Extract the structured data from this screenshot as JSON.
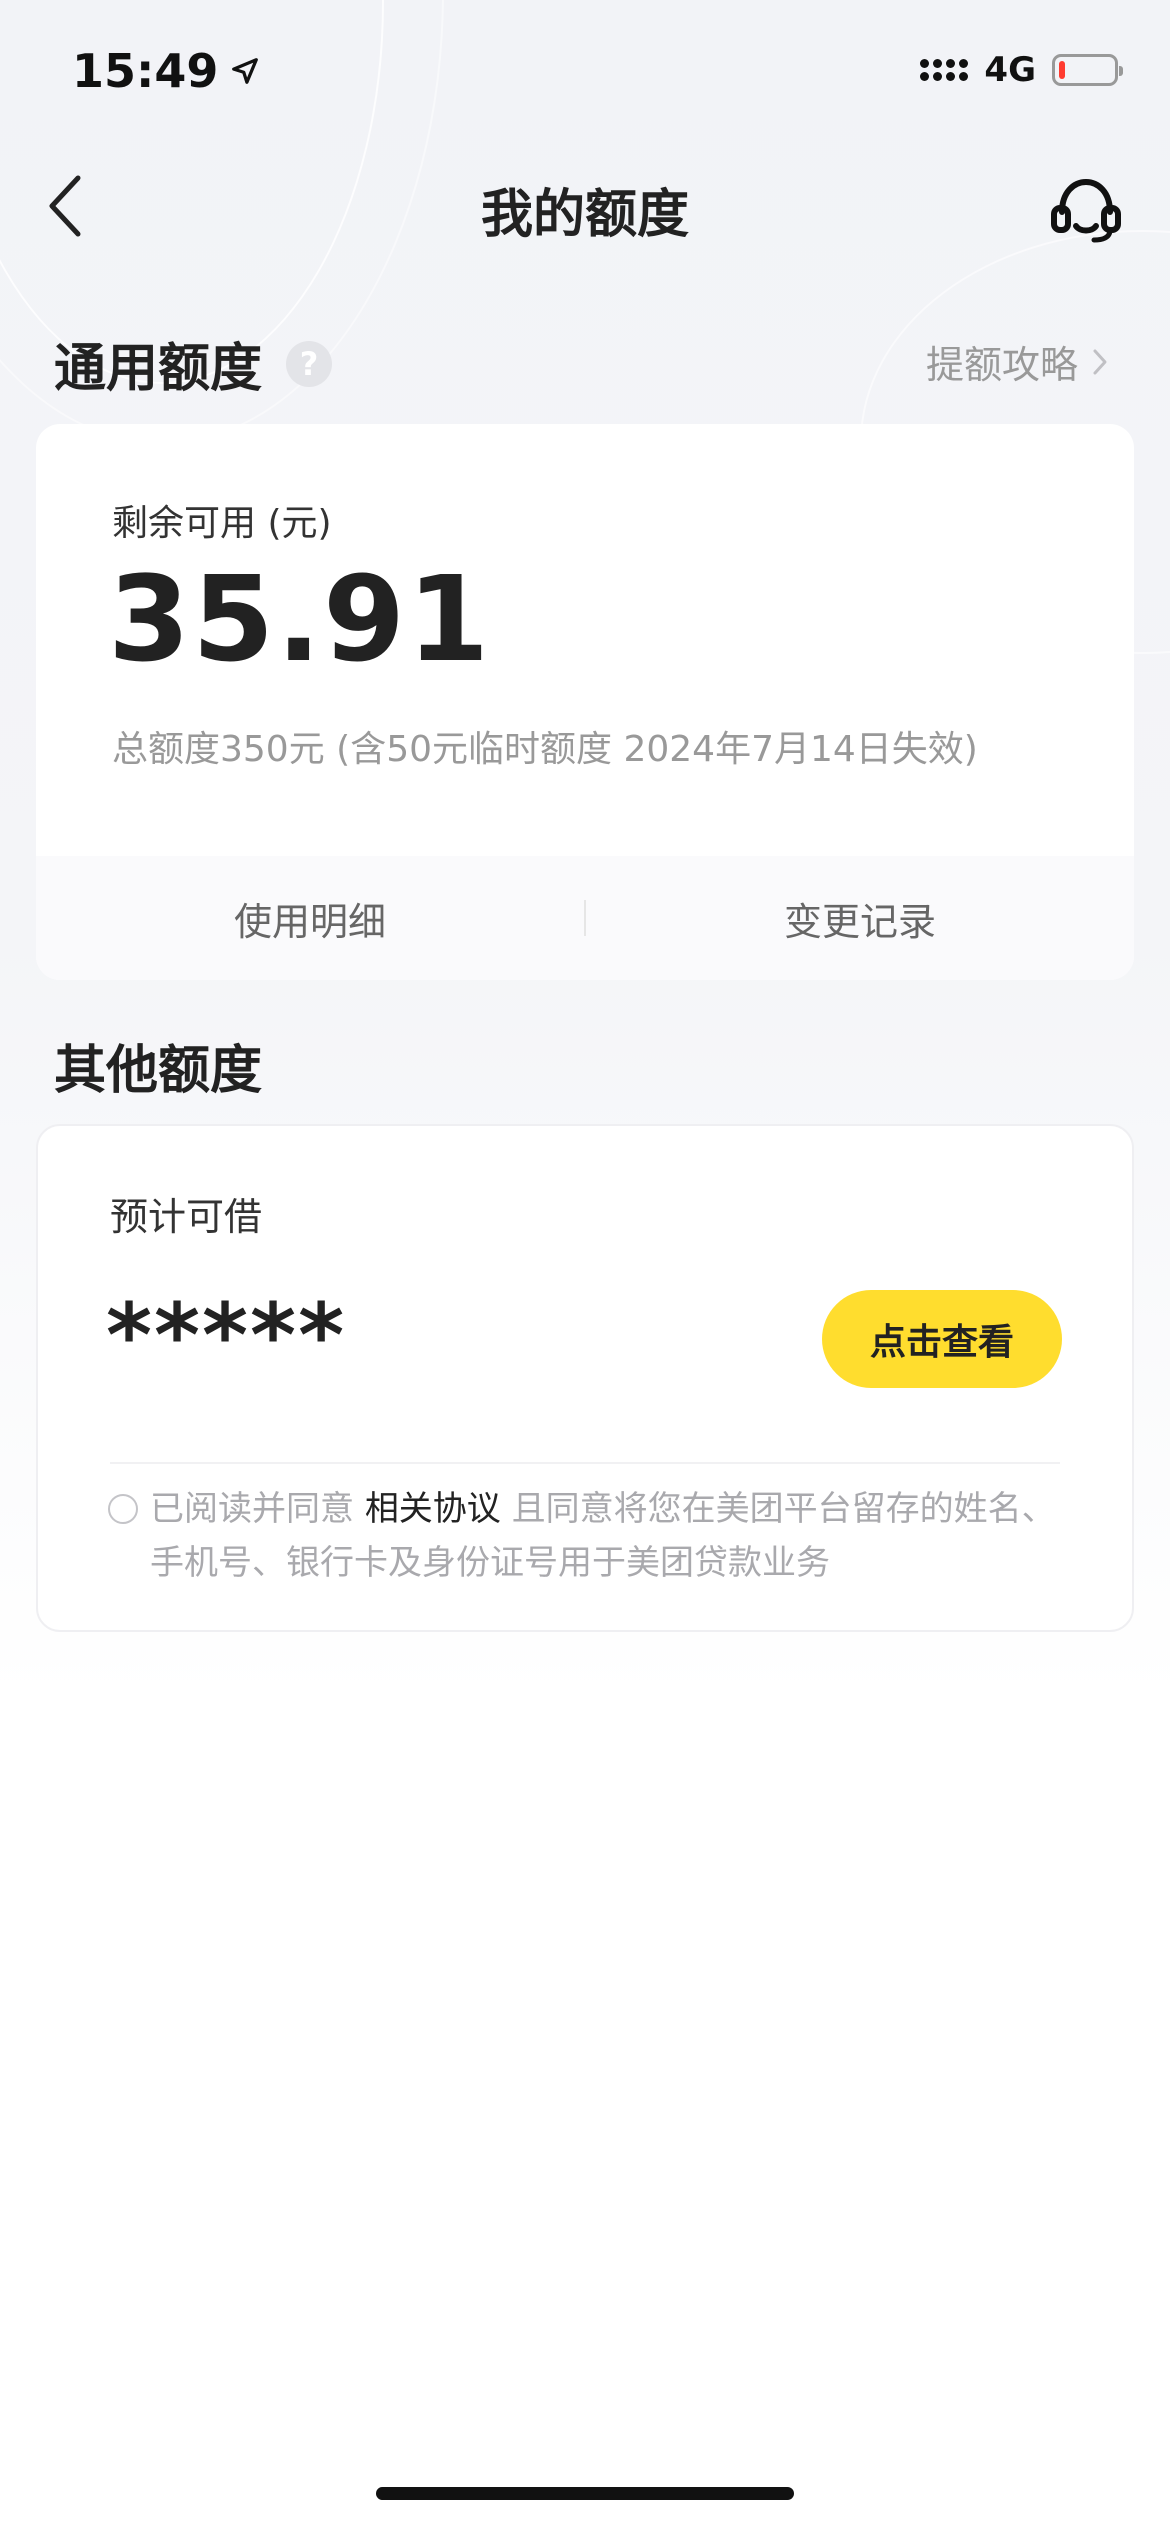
{
  "status_bar": {
    "time": "15:49",
    "network": "4G",
    "battery_level": 0.12,
    "battery_color": "#ff3b30"
  },
  "nav": {
    "back_icon": "chevron-left-icon",
    "title": "我的额度",
    "support_icon": "headset-icon"
  },
  "general_quota": {
    "section_title": "通用额度",
    "help_icon": "question-icon",
    "help_glyph": "?",
    "guide_link": "提额攻略",
    "guide_icon": "chevron-right-icon",
    "remaining_label": "剩余可用 (元)",
    "remaining_amount": "35.91",
    "total_desc": "总额度350元 (含50元临时额度 2024年7月14日失效)",
    "actions": {
      "usage_details": "使用明细",
      "change_records": "变更记录"
    }
  },
  "other_quota": {
    "section_title": "其他额度",
    "estimated_label": "预计可借",
    "masked_amount": "*****",
    "view_button": "点击查看",
    "agreement": {
      "prefix": "已阅读并同意 ",
      "link": "相关协议",
      "suffix": " 且同意将您在美团平台留存的姓名、手机号、银行卡及身份证号用于美团贷款业务"
    }
  },
  "colors": {
    "accent_yellow": "#ffdd2e",
    "page_bg": "#f3f4f7",
    "muted_text": "#999999"
  }
}
